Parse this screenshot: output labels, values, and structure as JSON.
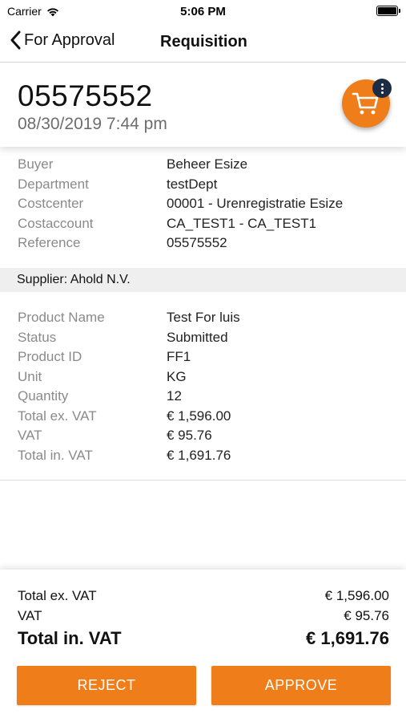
{
  "status_bar": {
    "carrier": "Carrier",
    "time": "5:06 PM"
  },
  "nav": {
    "back_label": "For Approval",
    "title": "Requisition"
  },
  "header": {
    "number": "05575552",
    "date": "08/30/2019 7:44 pm",
    "cart_icon": "cart-icon",
    "more_icon": "more-vertical-icon"
  },
  "general": [
    {
      "label": "Buyer",
      "value": "Beheer Esize"
    },
    {
      "label": "Department",
      "value": "testDept"
    },
    {
      "label": "Costcenter",
      "value": "00001 - Urenregistratie Esize"
    },
    {
      "label": "Costaccount",
      "value": "CA_TEST1 - CA_TEST1"
    },
    {
      "label": "Reference",
      "value": "05575552"
    }
  ],
  "supplier": "Supplier: Ahold N.V.",
  "product": [
    {
      "label": "Product Name",
      "value": "Test For luis"
    },
    {
      "label": "Status",
      "value": "Submitted"
    },
    {
      "label": "Product ID",
      "value": "FF1"
    },
    {
      "label": "Unit",
      "value": "KG"
    },
    {
      "label": "Quantity",
      "value": "12"
    },
    {
      "label": "Total ex. VAT",
      "value": "€ 1,596.00"
    },
    {
      "label": "VAT",
      "value": "€ 95.76"
    },
    {
      "label": "Total in. VAT",
      "value": "€ 1,691.76"
    }
  ],
  "summary": {
    "ex_vat_label": "Total ex. VAT",
    "ex_vat_value": "€ 1,596.00",
    "vat_label": "VAT",
    "vat_value": "€ 95.76",
    "total_label": "Total in. VAT",
    "total_value": "€ 1,691.76"
  },
  "actions": {
    "reject": "REJECT",
    "approve": "APPROVE"
  },
  "colors": {
    "accent": "#ef7d1a",
    "badge": "#1c2c44",
    "label_grey": "#8a8a8a"
  }
}
